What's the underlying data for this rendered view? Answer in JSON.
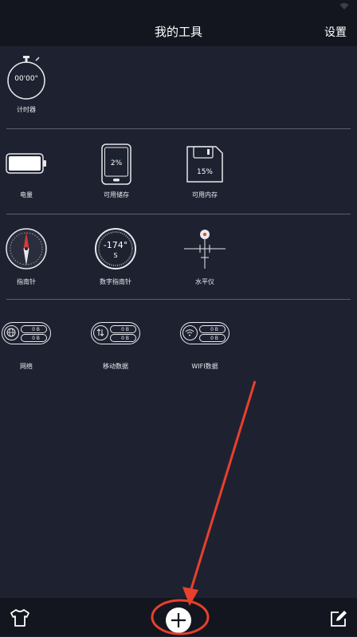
{
  "header": {
    "title": "我的工具",
    "settings_label": "设置"
  },
  "sections": {
    "timer": {
      "label": "计时器",
      "display": "00'00\""
    },
    "battery": {
      "label": "电量"
    },
    "storage": {
      "label": "可用储存",
      "value": "2%"
    },
    "memory": {
      "label": "可用内存",
      "value": "15%"
    },
    "compass": {
      "label": "指南针"
    },
    "digital_compass": {
      "label": "数字指南针",
      "heading": "-174°",
      "direction": "S"
    },
    "level": {
      "label": "水平仪"
    },
    "network": {
      "label": "网络",
      "up": "0 B",
      "down": "0 B"
    },
    "mobile_data": {
      "label": "移动数据",
      "up": "0 B",
      "down": "0 B"
    },
    "wifi_data": {
      "label": "WIFI数据",
      "up": "0 B",
      "down": "0 B"
    }
  },
  "icons": {
    "bottom_left": "shirt-icon",
    "center": "add-icon",
    "bottom_right": "edit-icon"
  },
  "colors": {
    "background": "#1e2230",
    "bar": "#14161f",
    "annotation": "#e8402c",
    "compass_needle": "#d63a3a"
  }
}
